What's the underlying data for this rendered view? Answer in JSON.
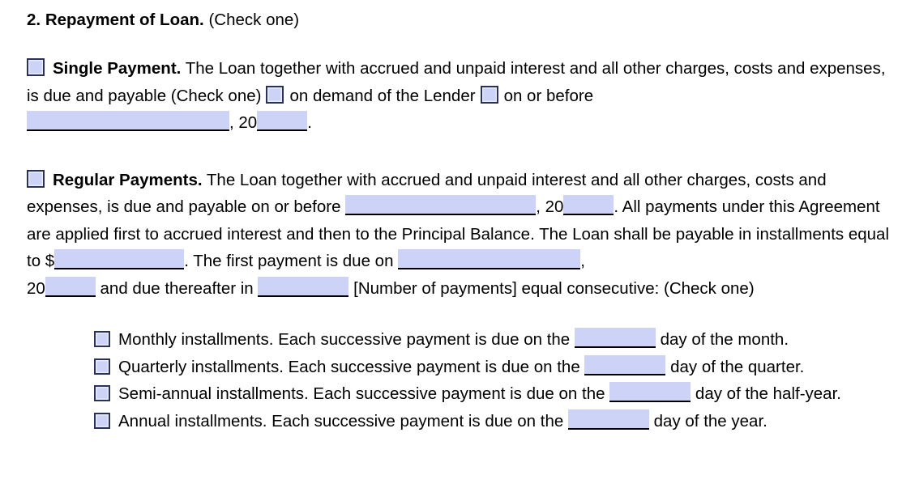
{
  "document": {
    "heading": {
      "number": "2.",
      "title": "Repayment of Loan.",
      "note": "(Check one)"
    },
    "single_payment": {
      "checkbox_name": "single-payment",
      "label": "Single Payment.",
      "text_1": "The Loan together with accrued and unpaid interest and all other charges, costs and expenses, is due and payable (Check one)",
      "option_on_demand": "on demand of the Lender",
      "option_on_or_before": "on or before",
      "blank_date": "",
      "year_prefix": "20",
      "blank_year": "",
      "period": "."
    },
    "regular_payments": {
      "checkbox_name": "regular-payments",
      "label": "Regular Payments.",
      "text_1": "The Loan together with accrued and unpaid interest and all other charges, costs and expenses, is due and payable on or before",
      "blank_due_date": "",
      "year_prefix_1": "20",
      "blank_due_year": "",
      "text_2": ". All payments under this Agreement are applied first to accrued interest and then to the Principal Balance. The Loan shall be payable in installments equal to $",
      "blank_amount": "",
      "text_3": ". The first payment is due on",
      "blank_first_payment_date": "",
      "year_prefix_2": "20",
      "blank_first_payment_year": "",
      "text_4": "and due thereafter in",
      "blank_number_of_payments": "",
      "text_5": "[Number of payments] equal consecutive: (Check one)"
    },
    "installment_options": [
      {
        "checkbox_name": "monthly-installments",
        "text_before": "Monthly installments. Each successive payment is due on the",
        "blank": "",
        "text_after": "day of the month."
      },
      {
        "checkbox_name": "quarterly-installments",
        "text_before": "Quarterly installments. Each successive payment is due on the",
        "blank": "",
        "text_after": "day of the quarter."
      },
      {
        "checkbox_name": "semi-annual-installments",
        "text_before": "Semi-annual installments. Each successive payment is due on the",
        "blank": "",
        "text_after": "day of the half-year."
      },
      {
        "checkbox_name": "annual-installments",
        "text_before": "Annual installments. Each successive payment is due on the",
        "blank": "",
        "text_after": "day of the year."
      }
    ],
    "colors": {
      "field_fill": "#ccd3f7",
      "checkbox_border": "#2b3257",
      "text": "#000000",
      "page_background": "#ffffff"
    }
  }
}
